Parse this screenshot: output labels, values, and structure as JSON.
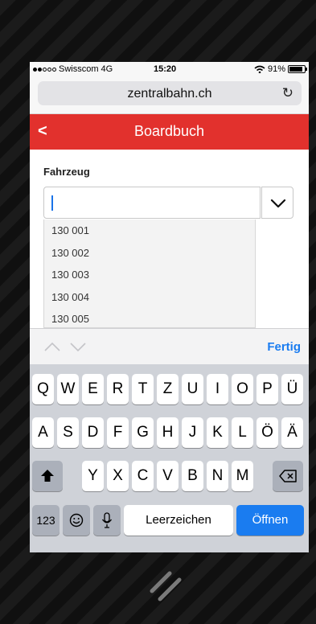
{
  "status": {
    "carrier": "Swisscom",
    "network": "4G",
    "time": "15:20",
    "battery_text": "91%",
    "battery_level": 0.91,
    "signal_bars": 2
  },
  "browser": {
    "url": "zentralbahn.ch",
    "reload_icon": "reload-icon"
  },
  "app": {
    "back_label": "<",
    "title": "Boardbuch"
  },
  "form": {
    "field_label": "Fahrzeug",
    "value": "",
    "dropdown_icon": "chevron-down-icon"
  },
  "suggestions": [
    "130 001",
    "130 002",
    "130 003",
    "130 004",
    "130 005"
  ],
  "accessory": {
    "done_label": "Fertig"
  },
  "keyboard": {
    "row1": [
      "Q",
      "W",
      "E",
      "R",
      "T",
      "Z",
      "U",
      "I",
      "O",
      "P",
      "Ü"
    ],
    "row2": [
      "A",
      "S",
      "D",
      "F",
      "G",
      "H",
      "J",
      "K",
      "L",
      "Ö",
      "Ä"
    ],
    "row3": [
      "Y",
      "X",
      "C",
      "V",
      "B",
      "N",
      "M"
    ],
    "numbers_label": "123",
    "space_label": "Leerzeichen",
    "return_label": "Öffnen"
  },
  "colors": {
    "brand_red": "#e2312d",
    "ios_blue": "#1a7cf0"
  }
}
